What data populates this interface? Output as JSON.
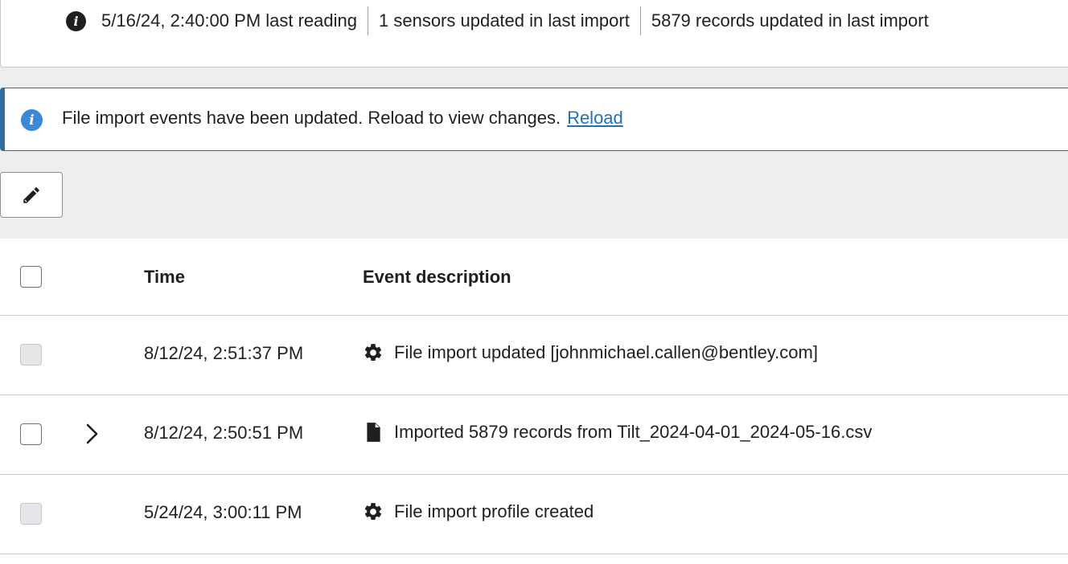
{
  "summary": {
    "last_reading": "5/16/24, 2:40:00 PM last reading",
    "sensors_updated": "1 sensors updated in last import",
    "records_updated": "5879 records updated in last import",
    "icon": "info-icon"
  },
  "banner": {
    "message": "File import events have been updated. Reload to view changes.",
    "link_label": "Reload",
    "icon": "info-icon",
    "accent_color": "#2f6f9f"
  },
  "toolbar": {
    "edit_icon": "pencil-icon"
  },
  "table": {
    "columns": [
      "Time",
      "Event description"
    ],
    "rows": [
      {
        "time": "8/12/24, 2:51:37 PM",
        "description": "File import updated [johnmichael.callen@bentley.com]",
        "icon": "gear-icon",
        "expandable": false,
        "selectable": false
      },
      {
        "time": "8/12/24, 2:50:51 PM",
        "description": "Imported 5879 records from Tilt_2024-04-01_2024-05-16.csv",
        "icon": "file-icon",
        "expandable": true,
        "selectable": true
      },
      {
        "time": "5/24/24, 3:00:11 PM",
        "description": "File import profile created",
        "icon": "gear-icon",
        "expandable": false,
        "selectable": false
      }
    ]
  }
}
